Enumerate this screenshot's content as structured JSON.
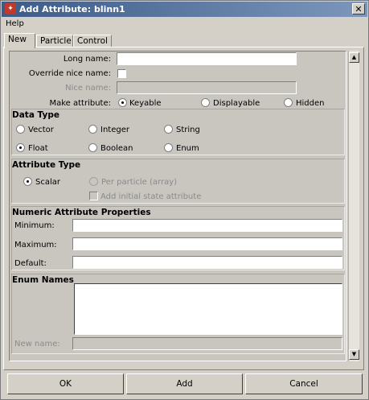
{
  "window": {
    "title": "Add Attribute: blinn1"
  },
  "menu": {
    "help": "Help"
  },
  "tabs": [
    {
      "label": "New"
    },
    {
      "label": "Particle"
    },
    {
      "label": "Control"
    }
  ],
  "form": {
    "long_name_label": "Long name:",
    "long_name_value": "",
    "override_nice_name_label": "Override nice name:",
    "override_nice_name_checked": false,
    "nice_name_label": "Nice name:",
    "nice_name_value": "",
    "make_attribute_label": "Make attribute:",
    "make_attribute_options": [
      "Keyable",
      "Displayable",
      "Hidden"
    ],
    "make_attribute_selected": "Keyable"
  },
  "data_type": {
    "title": "Data Type",
    "options": [
      "Vector",
      "Integer",
      "String",
      "Float",
      "Boolean",
      "Enum"
    ],
    "selected": "Float"
  },
  "attribute_type": {
    "title": "Attribute Type",
    "scalar": "Scalar",
    "per_particle": "Per particle (array)",
    "add_initial_state": "Add initial state attribute",
    "selected": "Scalar"
  },
  "numeric": {
    "title": "Numeric Attribute Properties",
    "minimum_label": "Minimum:",
    "minimum_value": "",
    "maximum_label": "Maximum:",
    "maximum_value": "",
    "default_label": "Default:",
    "default_value": ""
  },
  "enum": {
    "title": "Enum Names",
    "new_name_label": "New name:",
    "new_name_value": ""
  },
  "buttons": {
    "ok": "OK",
    "add": "Add",
    "cancel": "Cancel"
  },
  "colors": {
    "title_bar_start": "#3c5b87",
    "title_bar_end": "#7d97bb",
    "dialog_bg": "#d4d0c8"
  },
  "icons": {
    "app": "maya-app-icon",
    "close": "close-icon"
  }
}
